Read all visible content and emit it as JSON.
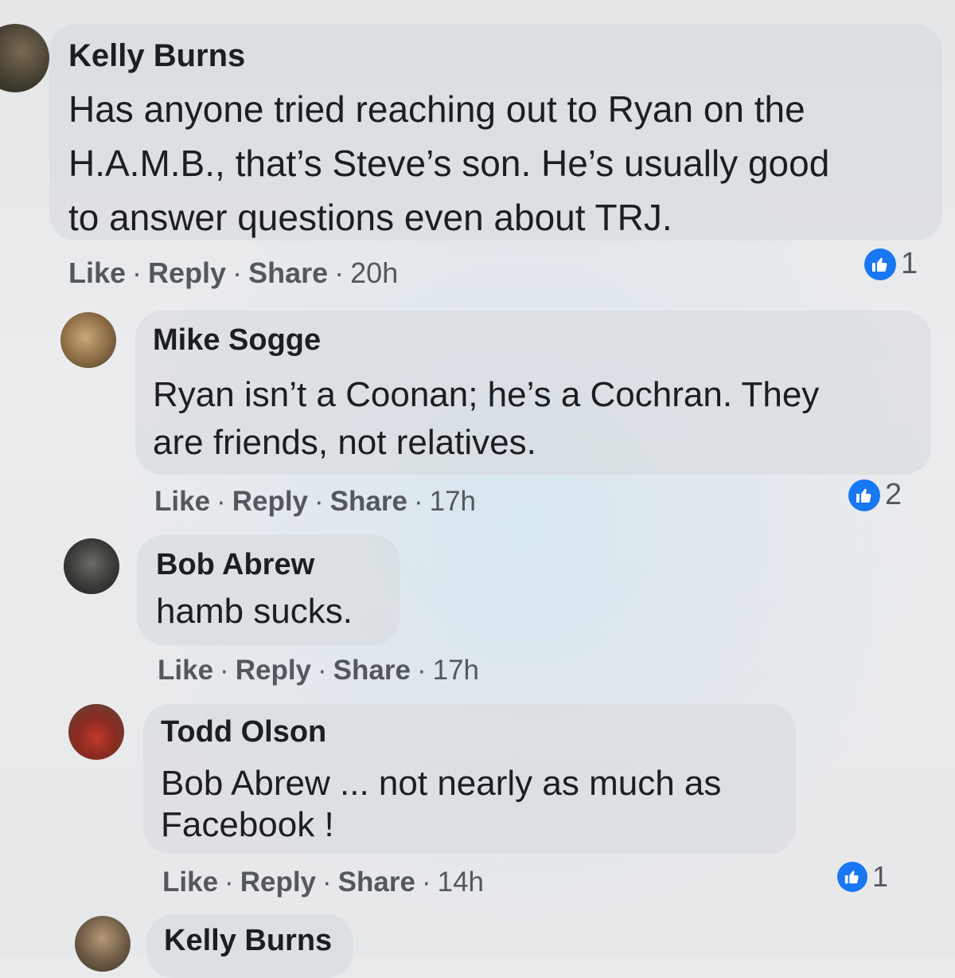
{
  "actions": {
    "like": "Like",
    "reply": "Reply",
    "share": "Share",
    "sep": "·"
  },
  "comments": [
    {
      "author": "Kelly Burns",
      "lines": [
        "Has anyone tried reaching out to Ryan on the",
        "H.A.M.B., that’s Steve’s son. He’s usually good",
        "to answer questions even about TRJ."
      ],
      "time": "20h",
      "reactions": "1"
    },
    {
      "author": "Mike Sogge",
      "lines": [
        "Ryan isn’t a Coonan; he’s a Cochran. They",
        "are friends, not relatives."
      ],
      "time": "17h",
      "reactions": "2"
    },
    {
      "author": "Bob Abrew",
      "lines": [
        "hamb sucks."
      ],
      "time": "17h"
    },
    {
      "author": "Todd Olson",
      "lines": [
        "Bob Abrew ... not nearly as much as",
        "Facebook !"
      ],
      "time": "14h",
      "reactions": "1"
    },
    {
      "author": "Kelly Burns"
    }
  ],
  "colors": {
    "accent": "#1877f2",
    "text": "#1c1e21",
    "muted": "#54585e"
  },
  "icons": [
    "avatar",
    "thumbs-up-icon"
  ]
}
